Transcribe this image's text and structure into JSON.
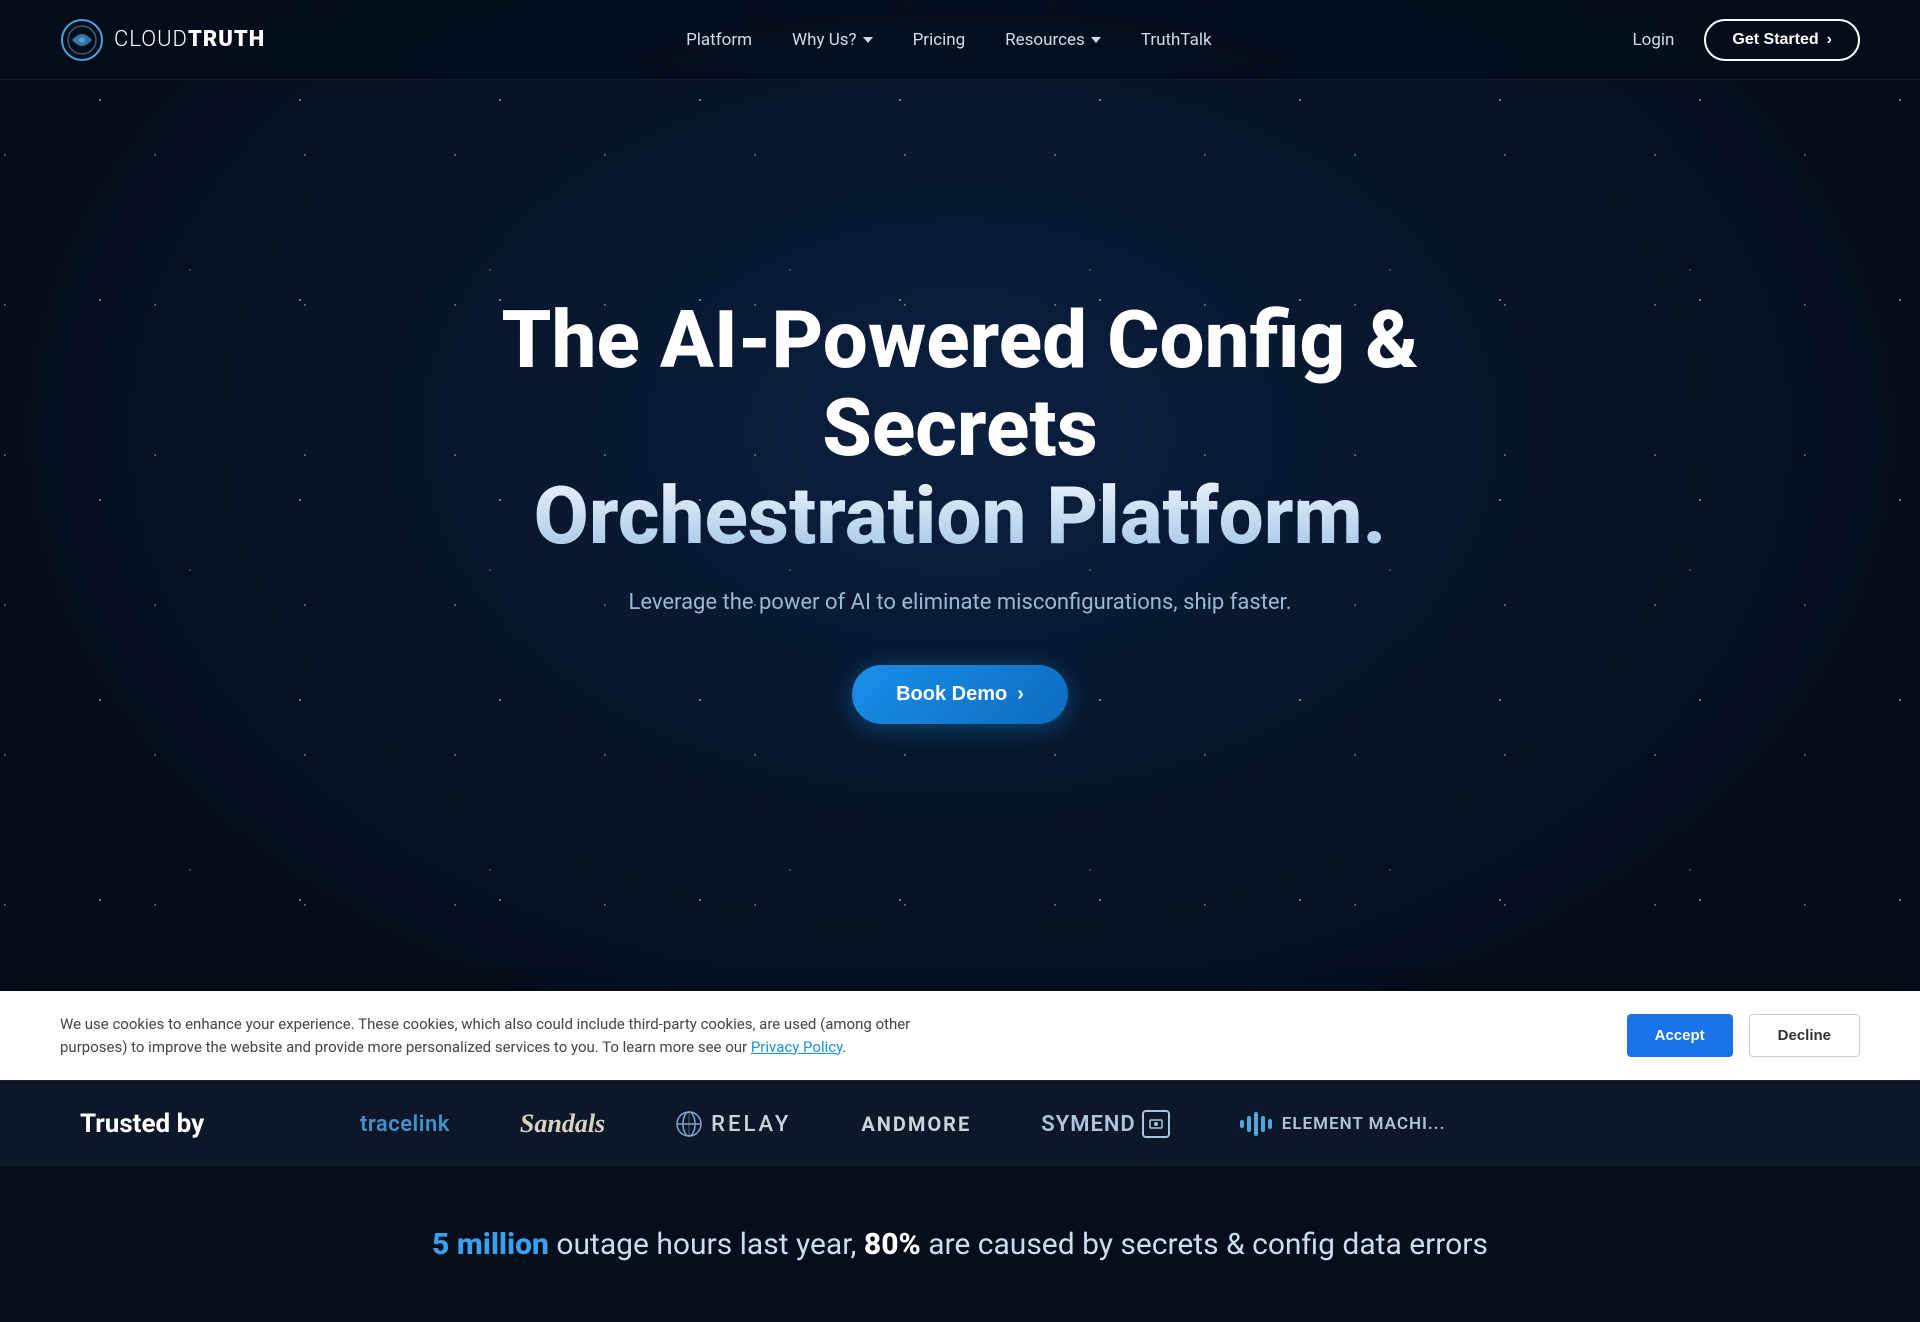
{
  "brand": {
    "name_part1": "CLOUD",
    "name_part2": "TRUTH",
    "logo_alt": "CloudTruth logo"
  },
  "nav": {
    "links": [
      {
        "label": "Platform",
        "has_dropdown": false
      },
      {
        "label": "Why Us?",
        "has_dropdown": true
      },
      {
        "label": "Pricing",
        "has_dropdown": false
      },
      {
        "label": "Resources",
        "has_dropdown": true
      },
      {
        "label": "TruthTalk",
        "has_dropdown": false
      }
    ],
    "login_label": "Login",
    "cta_label": "Get Started",
    "cta_arrow": "›"
  },
  "hero": {
    "title_line1": "The AI-Powered Config & Secrets",
    "title_line2": "Orchestration Platform.",
    "subtitle": "Leverage the power of AI to eliminate misconfigurations, ship faster.",
    "cta_label": "Book Demo",
    "cta_arrow": "›"
  },
  "trusted": {
    "label": "Trusted by",
    "logos": [
      {
        "name": "tracelink",
        "text": "tracelink"
      },
      {
        "name": "sandals",
        "text": "Sandals"
      },
      {
        "name": "relay",
        "text": "RELAY"
      },
      {
        "name": "andmore",
        "text": "ANDMORE"
      },
      {
        "name": "symend",
        "text": "SYMEND"
      },
      {
        "name": "element",
        "text": "ELEMENT MACHI..."
      }
    ]
  },
  "stats": {
    "highlight1": "5 million",
    "text1": " outage hours last year, ",
    "highlight2": "80%",
    "text2": " are caused by secrets & config data errors"
  },
  "cookie": {
    "text": "We use cookies to enhance your experience. These cookies, which also could include third-party cookies, are used (among other purposes) to improve the website and provide more personalized services to you. To learn more see our ",
    "link_text": "Privacy Policy",
    "accept_label": "Accept",
    "decline_label": "Decline"
  }
}
